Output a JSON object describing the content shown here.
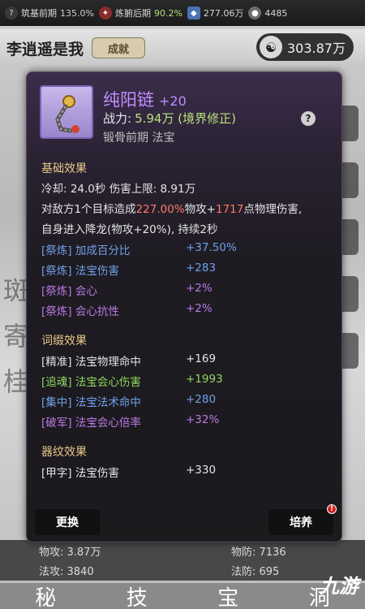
{
  "topbar": {
    "items": [
      {
        "label": "筑基前期",
        "value": "135.0%"
      },
      {
        "label": "炼腑后期",
        "value": "90.2%"
      },
      {
        "label": "277.06万",
        "value": ""
      },
      {
        "label": "4485",
        "value": ""
      }
    ]
  },
  "header": {
    "player_name": "李逍遥是我",
    "achievement_button": "成就",
    "currency_value": "303.87万"
  },
  "item": {
    "name": "纯阳链",
    "plus": "+20",
    "power_label": "战力:",
    "power_value": "5.94万 (境界修正)",
    "subtitle": "锻骨前期  法宝",
    "colors": {
      "name": "#c08cff",
      "power": "#b9e07a",
      "section": "#e8c98a"
    }
  },
  "basic": {
    "title": "基础效果",
    "cooldown_line": "冷却:  24.0秒  伤害上限:  8.91万",
    "desc_line1_a": "对敌方1个目标造成",
    "desc_line1_b": "227.00%",
    "desc_line1_c": "物攻+",
    "desc_line1_d": "1717",
    "desc_line1_e": "点物理伤害,",
    "desc_line2": "自身进入降龙(物攻+20%), 持续2秒",
    "refine": [
      {
        "label": "[祭炼] 加成百分比",
        "value": "+37.50%",
        "color": "#6fa0e8"
      },
      {
        "label": "[祭炼] 法宝伤害",
        "value": "+283",
        "color": "#6fa0e8"
      },
      {
        "label": "[祭炼] 会心",
        "value": "+2%",
        "color": "#b97ae6"
      },
      {
        "label": "[祭炼] 会心抗性",
        "value": "+2%",
        "color": "#b97ae6"
      }
    ]
  },
  "affix": {
    "title": "词缀效果",
    "rows": [
      {
        "label": "[精准]  法宝物理命中",
        "value": "+169",
        "color": "#e4e4e4"
      },
      {
        "label": "[追魂]  法宝会心伤害",
        "value": "+1993",
        "color": "#8fd860"
      },
      {
        "label": "[集中]  法宝法术命中",
        "value": "+280",
        "color": "#6fa0e8"
      },
      {
        "label": "[破军]  法宝会心倍率",
        "value": "+32%",
        "color": "#b97ae6"
      }
    ]
  },
  "engrave": {
    "title": "器纹效果",
    "rows": [
      {
        "label": "[甲字] 法宝伤害",
        "value": "+330",
        "color": "#e4e4e4"
      }
    ]
  },
  "buttons": {
    "replace": "更换",
    "train": "培养"
  },
  "background": {
    "stats": {
      "phys_atk": "物攻: 3.87万",
      "phys_def": "物防: 7136",
      "mag_atk": "法攻: 3840",
      "mag_def": "法防: 695"
    },
    "nav": [
      "秘",
      "技",
      "宝",
      "洞"
    ],
    "watermark": "九游",
    "left_chars": [
      "斑",
      "寄",
      "桂"
    ]
  }
}
